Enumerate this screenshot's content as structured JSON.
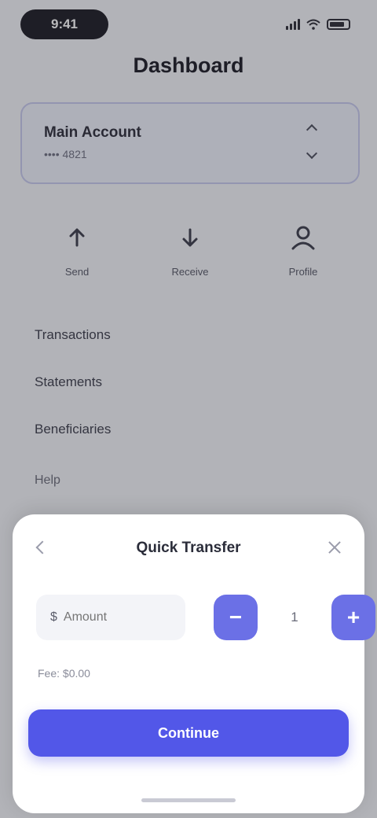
{
  "status_bar": {
    "time": "9:41",
    "icons": [
      "signal-icon",
      "wifi-icon",
      "battery-icon"
    ]
  },
  "page": {
    "title": "Dashboard"
  },
  "account": {
    "name": "Main Account",
    "subtitle": "•••• 4821"
  },
  "actions": [
    {
      "icon": "send-icon",
      "label": "Send"
    },
    {
      "icon": "receive-icon",
      "label": "Receive"
    },
    {
      "icon": "profile-icon",
      "label": "Profile"
    }
  ],
  "menu": {
    "items": [
      "Transactions",
      "Statements",
      "Beneficiaries"
    ],
    "footer_item": "Help"
  },
  "sheet": {
    "title": "Quick Transfer",
    "amount": {
      "currency": "$",
      "placeholder": "Amount",
      "value": ""
    },
    "stepper": {
      "minus_label": "−",
      "plus_label": "+",
      "value": "1"
    },
    "note": "Fee: $0.00",
    "primary_button": "Continue"
  },
  "colors": {
    "accent": "#5257e8",
    "stepper": "#6b70e6",
    "card_border": "#c6c9ee",
    "overlay": "rgba(40,40,48,0.32)"
  }
}
